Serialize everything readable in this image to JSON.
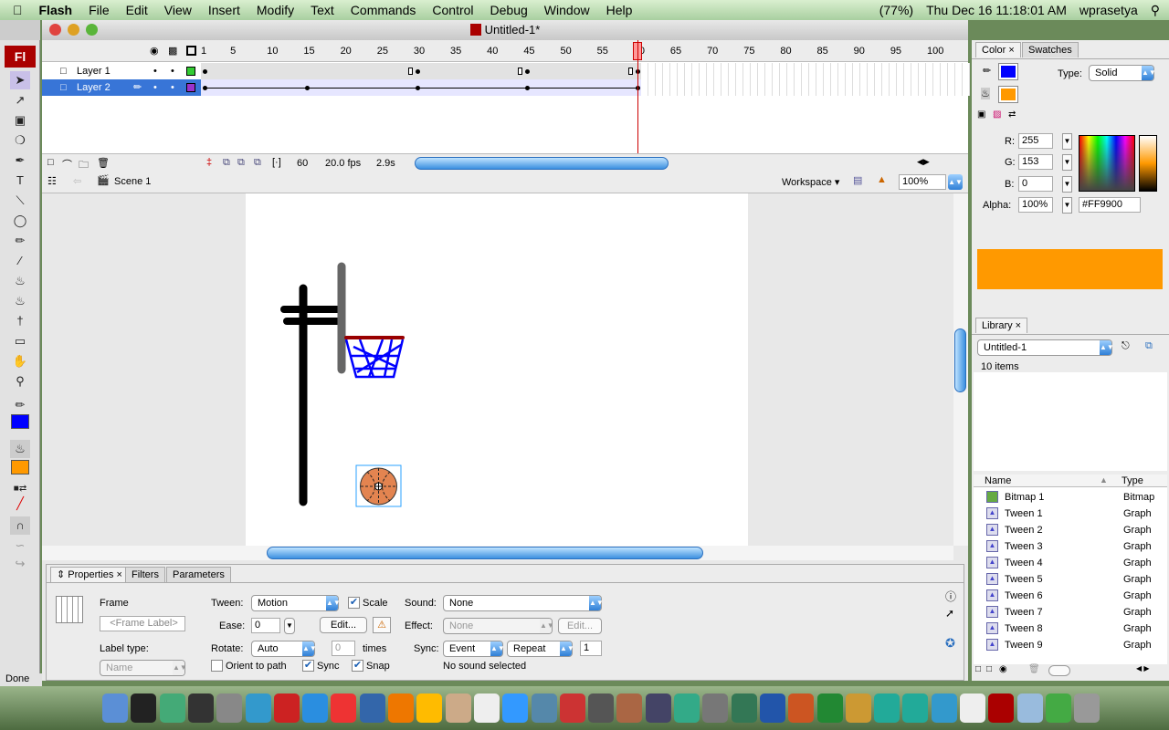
{
  "menubar": {
    "app": "Flash",
    "items": [
      "File",
      "Edit",
      "View",
      "Insert",
      "Modify",
      "Text",
      "Commands",
      "Control",
      "Debug",
      "Window",
      "Help"
    ],
    "battery": "(77%)",
    "datetime": "Thu Dec 16  11:18:01 AM",
    "user": "wprasetya"
  },
  "window": {
    "title": "Untitled-1*"
  },
  "toolbox": {
    "logo": "Fl",
    "status": "Done"
  },
  "timeline": {
    "ruler": [
      "1",
      "5",
      "10",
      "15",
      "20",
      "25",
      "30",
      "35",
      "40",
      "45",
      "50",
      "55",
      "60",
      "65",
      "70",
      "75",
      "80",
      "85",
      "90",
      "95",
      "100"
    ],
    "current_frame_marker": "60",
    "layers": [
      {
        "name": "Layer 1",
        "color": "#33cc33",
        "keyframes": [
          1,
          30,
          45,
          60
        ],
        "endframes": [
          29,
          44,
          59
        ],
        "selected": false
      },
      {
        "name": "Layer 2",
        "color": "#9933cc",
        "keyframes": [
          1,
          15,
          30,
          45,
          60
        ],
        "tween": "motion",
        "selected": true
      }
    ],
    "footer": {
      "frame": "60",
      "fps": "20.0 fps",
      "time": "2.9s"
    }
  },
  "editbar": {
    "scene": "Scene 1",
    "workspace": "Workspace",
    "zoom": "100%"
  },
  "properties": {
    "tabs": [
      "Properties",
      "Filters",
      "Parameters"
    ],
    "frame_label": "Frame",
    "frame_label_placeholder": "<Frame Label>",
    "label_type_label": "Label type:",
    "label_type": "Name",
    "tween_label": "Tween:",
    "tween": "Motion",
    "scale_label": "Scale",
    "scale": true,
    "ease_label": "Ease:",
    "ease": "0",
    "edit_label": "Edit...",
    "rotate_label": "Rotate:",
    "rotate": "Auto",
    "times_value": "0",
    "times_label": "times",
    "orient_label": "Orient to path",
    "orient": false,
    "sync_cb_label": "Sync",
    "sync_cb": true,
    "snap_label": "Snap",
    "snap": true,
    "sound_label": "Sound:",
    "sound": "None",
    "effect_label": "Effect:",
    "effect": "None",
    "effect_edit": "Edit...",
    "sync_label": "Sync:",
    "sync": "Event",
    "repeat": "Repeat",
    "repeat_count": "1",
    "no_sound": "No sound selected"
  },
  "color": {
    "tabs": [
      "Color",
      "Swatches"
    ],
    "stroke": "#0000ff",
    "fill": "#ff9900",
    "type_label": "Type:",
    "type": "Solid",
    "r_label": "R:",
    "r": "255",
    "g_label": "G:",
    "g": "153",
    "b_label": "B:",
    "b": "0",
    "alpha_label": "Alpha:",
    "alpha": "100%",
    "hex": "#FF9900"
  },
  "library": {
    "tab": "Library",
    "document": "Untitled-1",
    "count": "10 items",
    "col_name": "Name",
    "col_type": "Type",
    "items": [
      {
        "name": "Bitmap 1",
        "type": "Bitmap",
        "icon": "bitmap-icon"
      },
      {
        "name": "Tween 1",
        "type": "Graph",
        "icon": "graphic-icon"
      },
      {
        "name": "Tween 2",
        "type": "Graph",
        "icon": "graphic-icon"
      },
      {
        "name": "Tween 3",
        "type": "Graph",
        "icon": "graphic-icon"
      },
      {
        "name": "Tween 4",
        "type": "Graph",
        "icon": "graphic-icon"
      },
      {
        "name": "Tween 5",
        "type": "Graph",
        "icon": "graphic-icon"
      },
      {
        "name": "Tween 6",
        "type": "Graph",
        "icon": "graphic-icon"
      },
      {
        "name": "Tween 7",
        "type": "Graph",
        "icon": "graphic-icon"
      },
      {
        "name": "Tween 8",
        "type": "Graph",
        "icon": "graphic-icon"
      },
      {
        "name": "Tween 9",
        "type": "Graph",
        "icon": "graphic-icon"
      }
    ]
  },
  "dock": [
    "finder",
    "terminal",
    "preview",
    "dashboard",
    "system-preferences",
    "safari-alt",
    "acrobat",
    "safari",
    "chrome",
    "thunderbird",
    "firefox",
    "yahoo-messenger",
    "address-book",
    "ical",
    "itunes",
    "iphoto",
    "photo-booth",
    "imovie",
    "garageband",
    "spaces",
    "time-machine",
    "utility",
    "dreamweaver",
    "word",
    "powerpoint",
    "excel",
    "outlook",
    "messenger",
    "people",
    "globe",
    "textedit",
    "flash",
    "documents",
    "downloads",
    "trash"
  ]
}
